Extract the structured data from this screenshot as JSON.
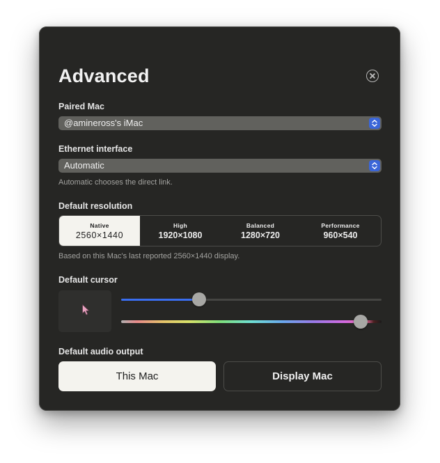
{
  "dialog": {
    "title": "Advanced"
  },
  "paired_mac": {
    "label": "Paired Mac",
    "value": "@amineross's iMac"
  },
  "ethernet": {
    "label": "Ethernet interface",
    "value": "Automatic",
    "help": "Automatic chooses the direct link."
  },
  "resolution": {
    "label": "Default resolution",
    "options": [
      {
        "name": "Native",
        "value": "2560×1440",
        "selected": true
      },
      {
        "name": "High",
        "value": "1920×1080",
        "selected": false
      },
      {
        "name": "Balanced",
        "value": "1280×720",
        "selected": false
      },
      {
        "name": "Performance",
        "value": "960×540",
        "selected": false
      }
    ],
    "help": "Based on this Mac's last reported 2560×1440 display."
  },
  "cursor": {
    "label": "Default cursor",
    "size_level": 0.3,
    "color_level": 0.92,
    "accent_color": "#3a6ef0",
    "preview_icon": "arrow-cursor-icon"
  },
  "audio": {
    "label": "Default audio output",
    "options": [
      "This Mac",
      "Display Mac"
    ],
    "selected": "This Mac"
  },
  "colors": {
    "window_bg": "#262624",
    "select_bg": "#61615d",
    "stepper_blue": "#3b66d8",
    "selected_bg": "#f4f3ee",
    "cursor_pink": "#e9a3c0"
  }
}
